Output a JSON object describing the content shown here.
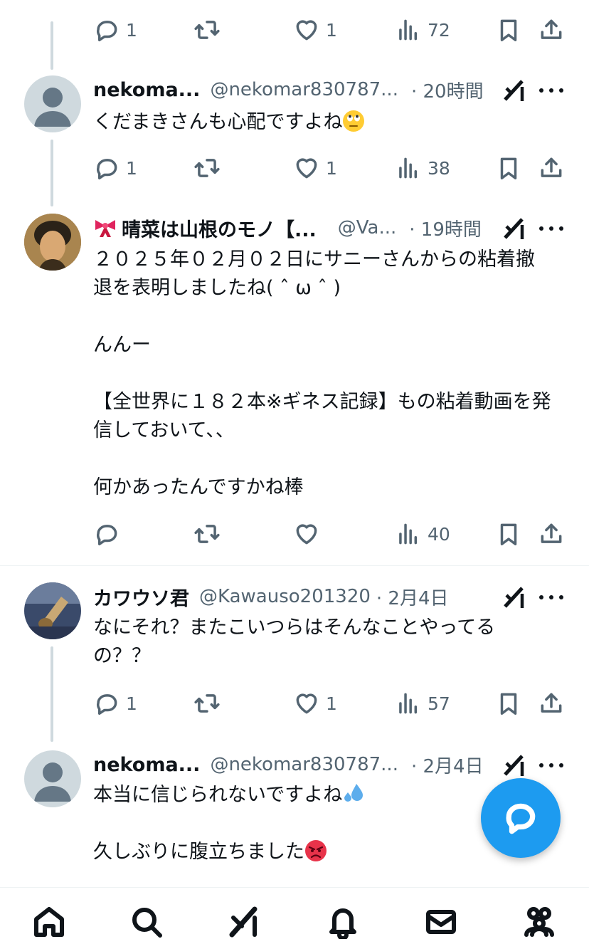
{
  "tweets": [
    {
      "actions": {
        "replies": "1",
        "retweets": "",
        "likes": "1",
        "views": "72"
      }
    },
    {
      "display_name": "nekoma...",
      "handle": "@nekomar830787...",
      "time": "· 20時間",
      "text": "くだまきさんも心配ですよね",
      "emoji": "face-with-rolling-eyes",
      "actions": {
        "replies": "1",
        "retweets": "",
        "likes": "1",
        "views": "38"
      }
    },
    {
      "display_name": "晴菜は山根のモノ【...",
      "name_emoji": "ribbon",
      "handle": "@Va...",
      "time": "· 19時間",
      "text_lines": [
        "２０２５年０２月０２日にサニーさんからの粘着撤",
        "退を表明しましたね( ˆ ω ˆ )",
        "",
        "んんー",
        "",
        "【全世界に１８２本※ギネス記録】もの粘着動画を発",
        "信しておいて、、",
        "",
        "何かあったんですかね棒"
      ],
      "actions": {
        "replies": "",
        "retweets": "",
        "likes": "",
        "views": "40"
      }
    },
    {
      "display_name": "カワウソ君",
      "handle": "@Kawauso201320",
      "time": "· 2月4日",
      "text_lines": [
        "なにそれ？またこいつらはそんなことやってる",
        "の？？"
      ],
      "actions": {
        "replies": "1",
        "retweets": "",
        "likes": "1",
        "views": "57"
      }
    },
    {
      "display_name": "nekoma...",
      "handle": "@nekomar830787...",
      "time": "· 2月4日",
      "text_lines": [
        "本当に信じられないですよね",
        "",
        "久しぶりに腹立ちました"
      ],
      "emojis": [
        "sweat-droplets",
        "angry-face"
      ]
    }
  ],
  "tabs": [
    "home",
    "search",
    "grok",
    "notifications",
    "messages",
    "communities"
  ],
  "colors": {
    "accent": "#1d9bf0",
    "muted": "#536471",
    "text": "#0f1419",
    "thread_line": "#cfd9de"
  }
}
